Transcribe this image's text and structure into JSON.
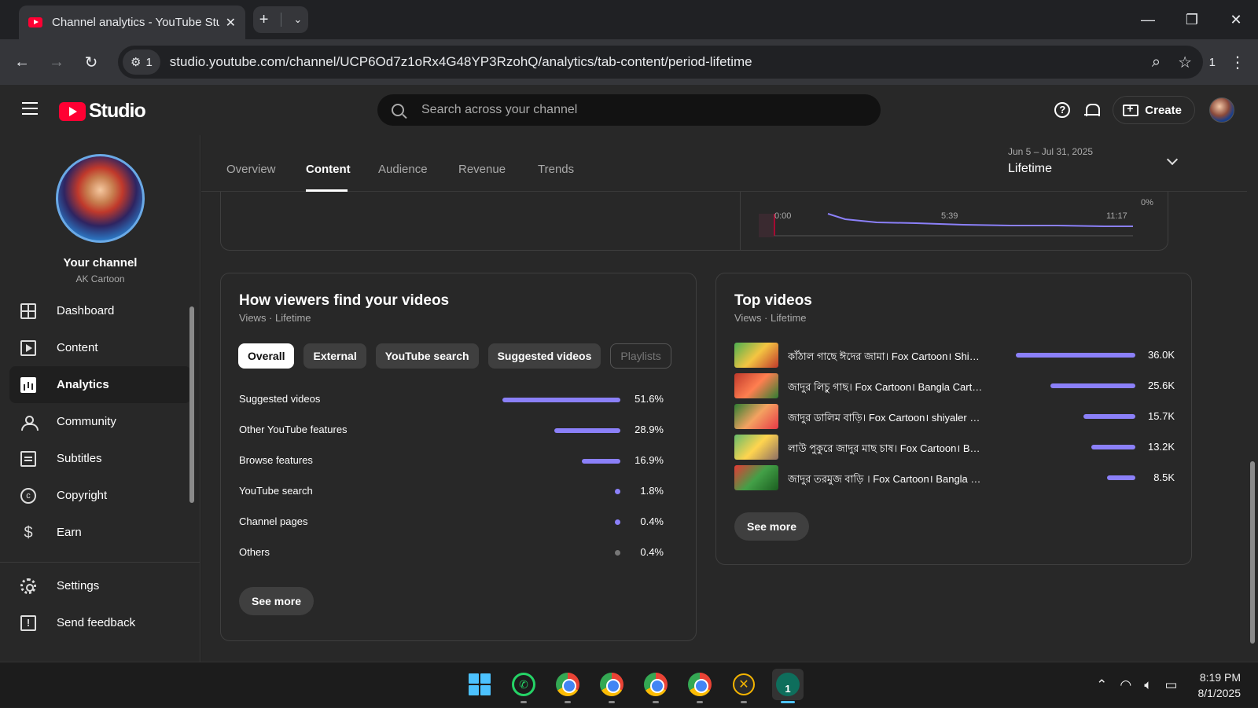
{
  "browser": {
    "tab_title": "Channel analytics - YouTube Studio",
    "url": "studio.youtube.com/channel/UCP6Od7z1oRx4G48YP3RzohQ/analytics/tab-content/period-lifetime",
    "site_info_count": "1",
    "profile_count": "1"
  },
  "header": {
    "logo_text": "Studio",
    "search_placeholder": "Search across your channel",
    "create_label": "Create"
  },
  "sidebar": {
    "channel_title": "Your channel",
    "channel_name": "AK Cartoon",
    "items": [
      {
        "label": "Dashboard",
        "icon": "dashboard-icon"
      },
      {
        "label": "Content",
        "icon": "content-icon"
      },
      {
        "label": "Analytics",
        "icon": "analytics-icon",
        "active": true
      },
      {
        "label": "Community",
        "icon": "community-icon"
      },
      {
        "label": "Subtitles",
        "icon": "subtitles-icon"
      },
      {
        "label": "Copyright",
        "icon": "copyright-icon"
      },
      {
        "label": "Earn",
        "icon": "dollar-icon"
      }
    ],
    "bottom_items": [
      {
        "label": "Settings",
        "icon": "gear-icon"
      },
      {
        "label": "Send feedback",
        "icon": "feedback-icon"
      }
    ]
  },
  "main": {
    "tabs": [
      "Overview",
      "Content",
      "Audience",
      "Revenue",
      "Trends"
    ],
    "active_tab": "Content",
    "period": {
      "range": "Jun 5 – Jul 31, 2025",
      "label": "Lifetime"
    },
    "retention_ticks": {
      "x": [
        "0:00",
        "5:39",
        "11:17"
      ],
      "y_bottom": "0%"
    },
    "traffic": {
      "title": "How viewers find your videos",
      "subtitle": "Views · Lifetime",
      "chips": [
        "Overall",
        "External",
        "YouTube search",
        "Suggested videos",
        "Playlists"
      ],
      "sources": [
        {
          "name": "Suggested videos",
          "value": "51.6%",
          "pct": 51.6
        },
        {
          "name": "Other YouTube features",
          "value": "28.9%",
          "pct": 28.9
        },
        {
          "name": "Browse features",
          "value": "16.9%",
          "pct": 16.9
        },
        {
          "name": "YouTube search",
          "value": "1.8%",
          "pct": 1.8
        },
        {
          "name": "Channel pages",
          "value": "0.4%",
          "pct": 0.4
        },
        {
          "name": "Others",
          "value": "0.4%",
          "pct": 0.4
        }
      ],
      "see_more": "See more"
    },
    "top_videos": {
      "title": "Top videos",
      "subtitle": "Views · Lifetime",
      "videos": [
        {
          "title": "কাঁঠাল গাছে ঈদের জামা। Fox Cartoon। Shiyaler Golpo",
          "value": "36.0K",
          "views": 36000
        },
        {
          "title": "জাদুর লিচু গাছ। Fox Cartoon। Bangla Cartoon",
          "value": "25.6K",
          "views": 25600
        },
        {
          "title": "জাদুর ডালিম বাড়ি। Fox Cartoon। shiyaler golpo",
          "value": "15.7K",
          "views": 15700
        },
        {
          "title": "লাউ পুকুরে জাদুর মাছ চাষ। Fox Cartoon। Bangla",
          "value": "13.2K",
          "views": 13200
        },
        {
          "title": "জাদুর তরমুজ বাড়ি । Fox Cartoon। Bangla Cartoon",
          "value": "8.5K",
          "views": 8500
        }
      ],
      "see_more": "See more"
    }
  },
  "taskbar": {
    "time": "8:19 PM",
    "date": "8/1/2025",
    "terminal_badge": "1"
  },
  "colors": {
    "accent": "#8b80f9",
    "youtube_red": "#ff0033",
    "background": "#282828"
  }
}
